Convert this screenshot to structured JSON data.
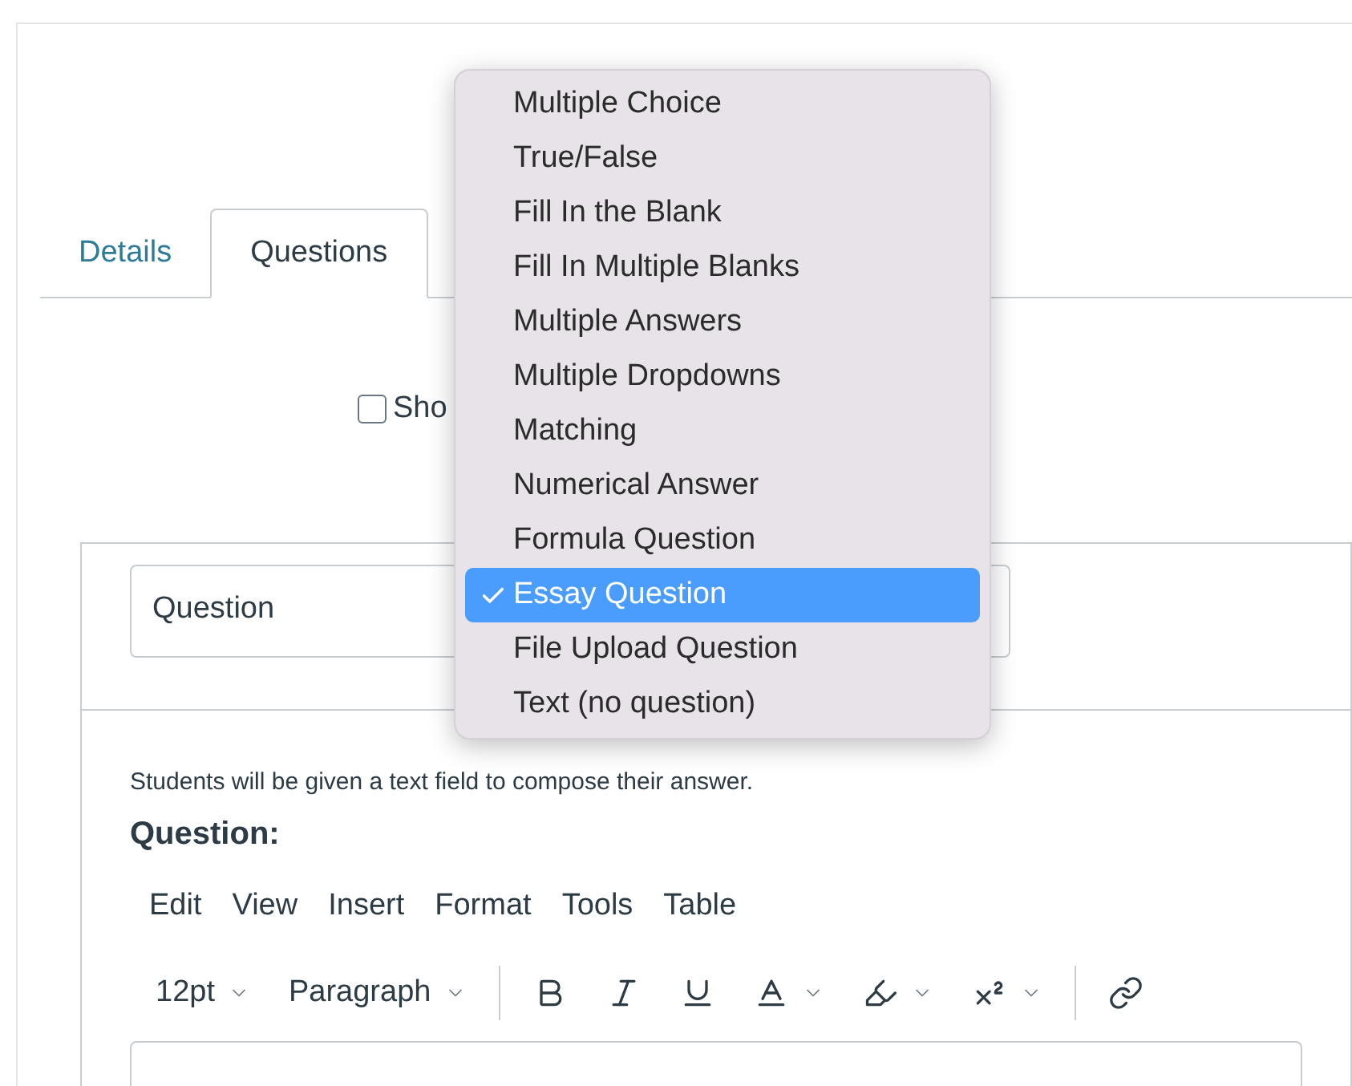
{
  "tabs": [
    {
      "label": "Details",
      "selected": false
    },
    {
      "label": "Questions",
      "selected": true
    }
  ],
  "show_checkbox": {
    "label": "Sho",
    "checked": false
  },
  "question_type_field": {
    "value": "Question"
  },
  "question_type_menu": [
    {
      "label": "Multiple Choice",
      "selected": false
    },
    {
      "label": "True/False",
      "selected": false
    },
    {
      "label": "Fill In the Blank",
      "selected": false
    },
    {
      "label": "Fill In Multiple Blanks",
      "selected": false
    },
    {
      "label": "Multiple Answers",
      "selected": false
    },
    {
      "label": "Multiple Dropdowns",
      "selected": false
    },
    {
      "label": "Matching",
      "selected": false
    },
    {
      "label": "Numerical Answer",
      "selected": false
    },
    {
      "label": "Formula Question",
      "selected": false
    },
    {
      "label": "Essay Question",
      "selected": true
    },
    {
      "label": "File Upload Question",
      "selected": false
    },
    {
      "label": "Text (no question)",
      "selected": false
    }
  ],
  "description": "Students will be given a text field to compose their answer.",
  "question_heading": "Question:",
  "editor_menu": [
    "Edit",
    "View",
    "Insert",
    "Format",
    "Tools",
    "Table"
  ],
  "editor_toolbar": [
    {
      "kind": "dropdown",
      "label": "12pt"
    },
    {
      "kind": "dropdown",
      "label": "Paragraph"
    },
    {
      "kind": "divider"
    },
    {
      "kind": "bold"
    },
    {
      "kind": "italic"
    },
    {
      "kind": "underline"
    },
    {
      "kind": "text-color"
    },
    {
      "kind": "highlight"
    },
    {
      "kind": "superscript"
    },
    {
      "kind": "divider"
    },
    {
      "kind": "link"
    }
  ]
}
